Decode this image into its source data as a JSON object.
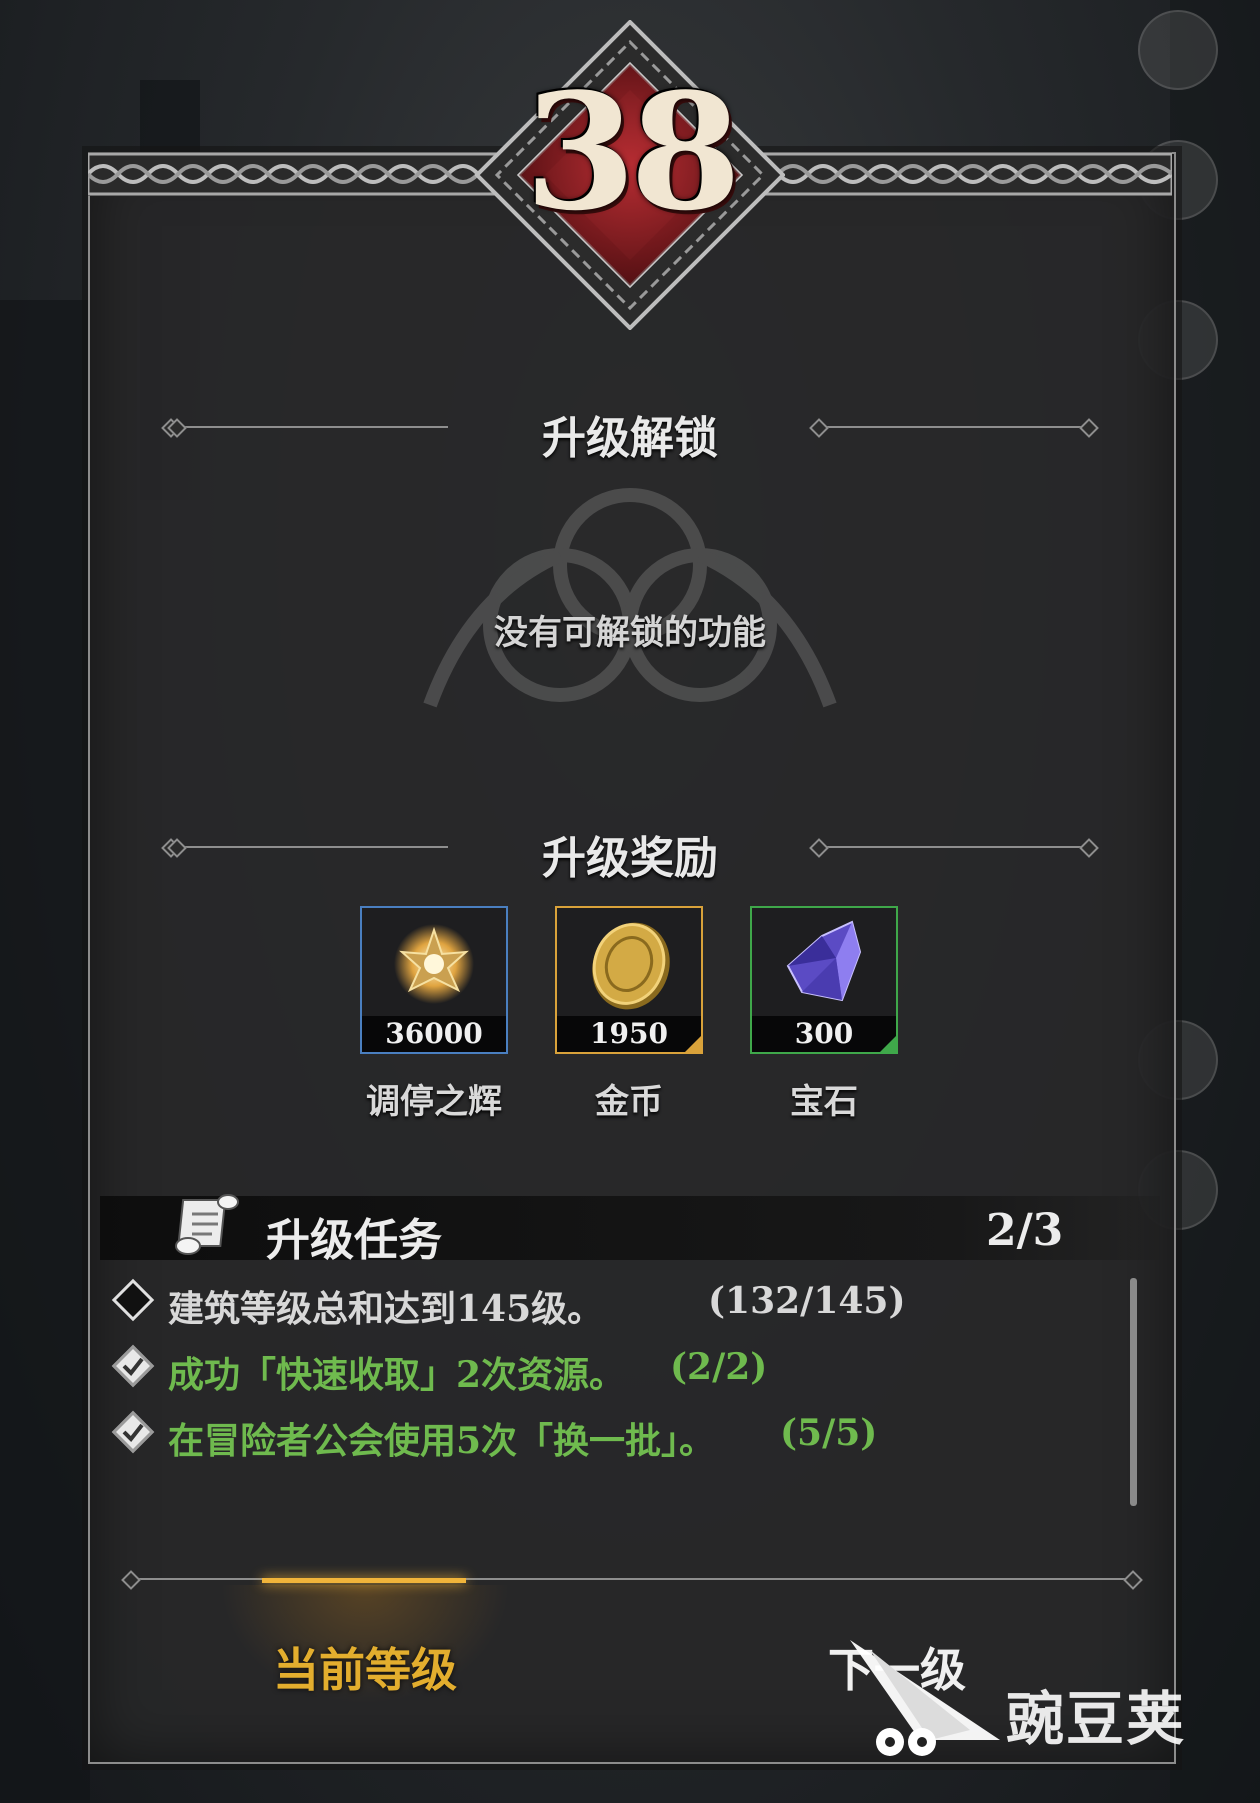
{
  "level": "38",
  "unlock": {
    "title": "升级解锁",
    "empty_text": "没有可解锁的功能"
  },
  "rewards": {
    "title": "升级奖励",
    "items": [
      {
        "icon": "star-light-icon",
        "quantity": "36000",
        "name": "调停之辉",
        "rarity_color": "#4a7fc0"
      },
      {
        "icon": "gold-coin-icon",
        "quantity": "1950",
        "name": "金币",
        "rarity_color": "#d9a23a"
      },
      {
        "icon": "gem-icon",
        "quantity": "300",
        "name": "宝石",
        "rarity_color": "#3fa84a"
      }
    ]
  },
  "tasks": {
    "title": "升级任务",
    "progress": "2/3",
    "items": [
      {
        "text": "建筑等级总和达到145级。",
        "count": "(132/145)",
        "done": false,
        "color": "#d8d8d8"
      },
      {
        "text": "成功「快速收取」2次资源。",
        "count": "(2/2)",
        "done": true,
        "color": "#6fba4e"
      },
      {
        "text": "在冒险者公会使用5次「换一批」。",
        "count": "(5/5)",
        "done": true,
        "color": "#6fba4e"
      }
    ]
  },
  "tabs": {
    "current": "当前等级",
    "next": "下一级"
  },
  "watermark": "豌豆荚",
  "colors": {
    "accent_gold": "#e3ae2e",
    "done_green": "#6fba4e",
    "badge_red": "#8e1d22"
  }
}
